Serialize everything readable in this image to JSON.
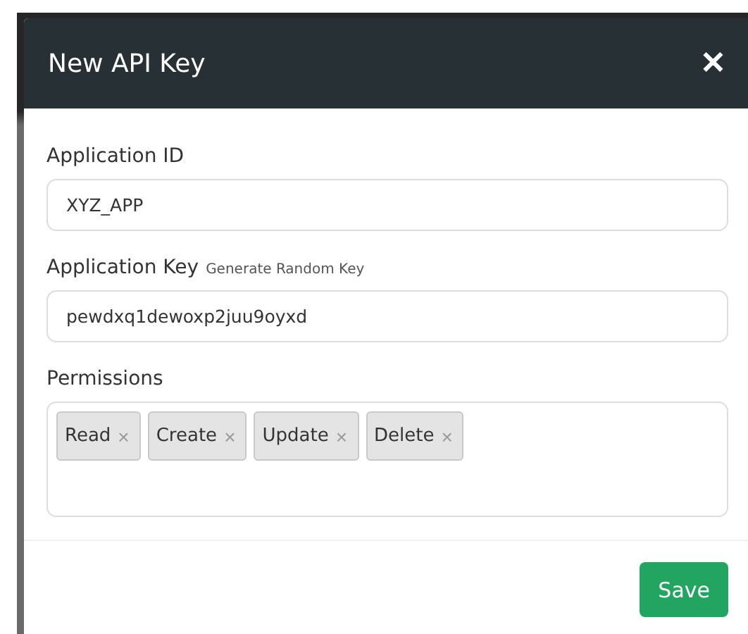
{
  "modal": {
    "title": "New API Key",
    "close": "✕"
  },
  "fields": [
    {
      "label": "Application ID",
      "value": "XYZ_APP"
    },
    {
      "label": "Application Key",
      "link": "Generate Random Key",
      "value": "pewdxq1dewoxp2juu9oyxd"
    }
  ],
  "permissions": {
    "label": "Permissions",
    "tags": [
      {
        "label": "Read",
        "remove": "×"
      },
      {
        "label": "Create",
        "remove": "×"
      },
      {
        "label": "Update",
        "remove": "×"
      },
      {
        "label": "Delete",
        "remove": "×"
      }
    ]
  },
  "buttons": [
    {
      "label": "Save",
      "kind": "primary"
    }
  ]
}
